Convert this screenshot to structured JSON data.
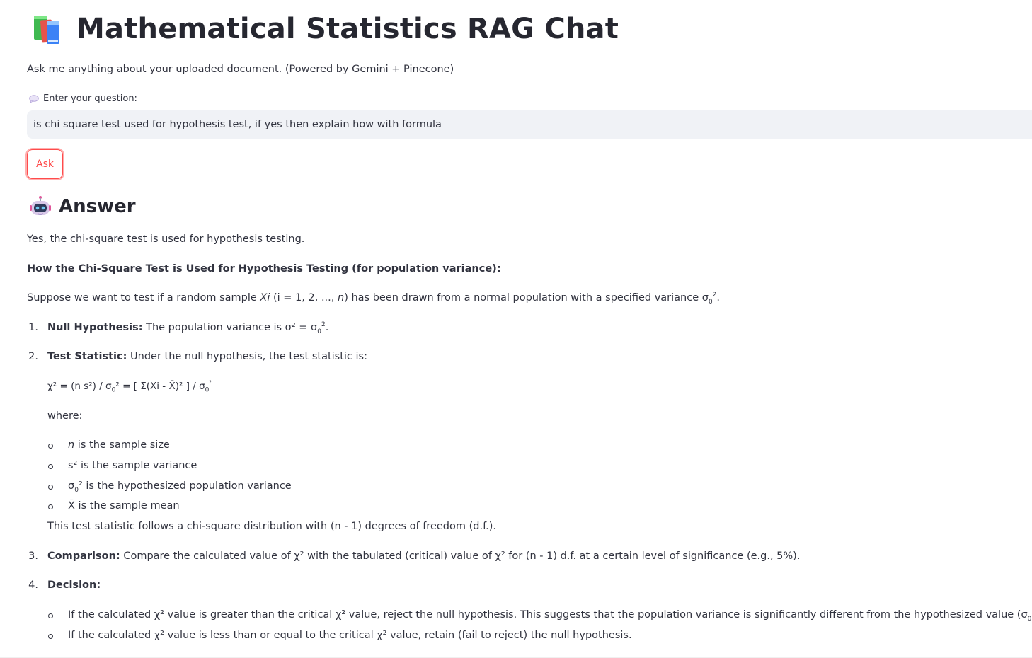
{
  "header": {
    "title": "Mathematical Statistics RAG Chat",
    "title_icon": "books-icon",
    "subtitle": "Ask me anything about your uploaded document. (Powered by Gemini + Pinecone)"
  },
  "question": {
    "label": "Enter your question:",
    "label_icon": "speech-bubble-icon",
    "value": "is chi square test used for hypothesis test, if yes then explain how with formula",
    "ask_label": "Ask"
  },
  "answer": {
    "heading": "Answer",
    "heading_icon": "robot-icon",
    "intro": "Yes, the chi-square test is used for hypothesis testing.",
    "howto": "How the Chi-Square Test is Used for Hypothesis Testing (for population variance):",
    "suppose_a": "Suppose we want to test if a random sample ",
    "suppose_xi": "Xi",
    "suppose_b": " (i = 1, 2, ..., ",
    "suppose_n": "n",
    "suppose_c": ") has been drawn from a normal population with a specified variance σ",
    "suppose_d": ".",
    "steps": [
      {
        "num": "1.",
        "bold": "Null Hypothesis:",
        "text": " The population variance is σ² = σ"
      },
      {
        "num": "2.",
        "bold": "Test Statistic:",
        "text": " Under the null hypothesis, the test statistic is:"
      },
      {
        "num": "3.",
        "bold": "Comparison:",
        "text": " Compare the calculated value of χ² with the tabulated (critical) value of χ² for (n - 1) d.f. at a certain level of significance (e.g., 5%)."
      },
      {
        "num": "4.",
        "bold": "Decision:",
        "text": ""
      }
    ],
    "formula_a": "χ² = (n s²) / σ",
    "formula_b": "² = [ Σ(Xi - X̄)² ] / σ",
    "formula_c": "²",
    "where": "where:",
    "where_items": [
      {
        "italic": "n",
        "text": " is the sample size"
      },
      {
        "italic": "",
        "text": "s² is the sample variance"
      },
      {
        "italic": "",
        "text": "σ"
      },
      {
        "italic": "",
        "text": "X̄ is the sample mean"
      }
    ],
    "sigma_hyp_rest": "² is the hypothesized population variance",
    "follows": "This test statistic follows a chi-square distribution with (n - 1) degrees of freedom (d.f.).",
    "decision_items": [
      "If the calculated χ² value is greater than the critical χ² value, reject the null hypothesis. This suggests that the population variance is significantly different from the hypothesized value (σ",
      "If the calculated χ² value is less than or equal to the critical χ² value, retain (fail to reject) the null hypothesis."
    ],
    "decision_1_end": ").",
    "sub0": "0",
    "sup2": "2",
    "period": "."
  }
}
